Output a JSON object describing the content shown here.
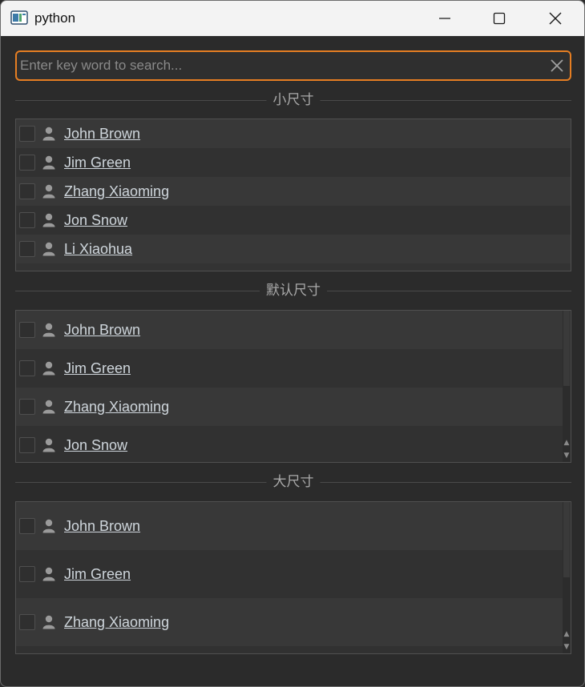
{
  "window": {
    "title": "python"
  },
  "search": {
    "placeholder": "Enter key word to search..."
  },
  "sections": [
    {
      "label": "小尺寸",
      "items": [
        "John Brown",
        "Jim Green",
        "Zhang Xiaoming",
        "Jon Snow",
        "Li Xiaohua"
      ]
    },
    {
      "label": "默认尺寸",
      "items": [
        "John Brown",
        "Jim Green",
        "Zhang Xiaoming",
        "Jon Snow"
      ]
    },
    {
      "label": "大尺寸",
      "items": [
        "John Brown",
        "Jim Green",
        "Zhang Xiaoming"
      ]
    }
  ],
  "icons": {
    "app": "python-app-icon",
    "minimize": "minimize-icon",
    "maximize": "maximize-icon",
    "close": "close-icon",
    "clear": "clear-x-icon",
    "user": "user-icon"
  },
  "colors": {
    "accent": "#e67e22",
    "background": "#2b2b2b",
    "text": "#cfd6dc"
  }
}
